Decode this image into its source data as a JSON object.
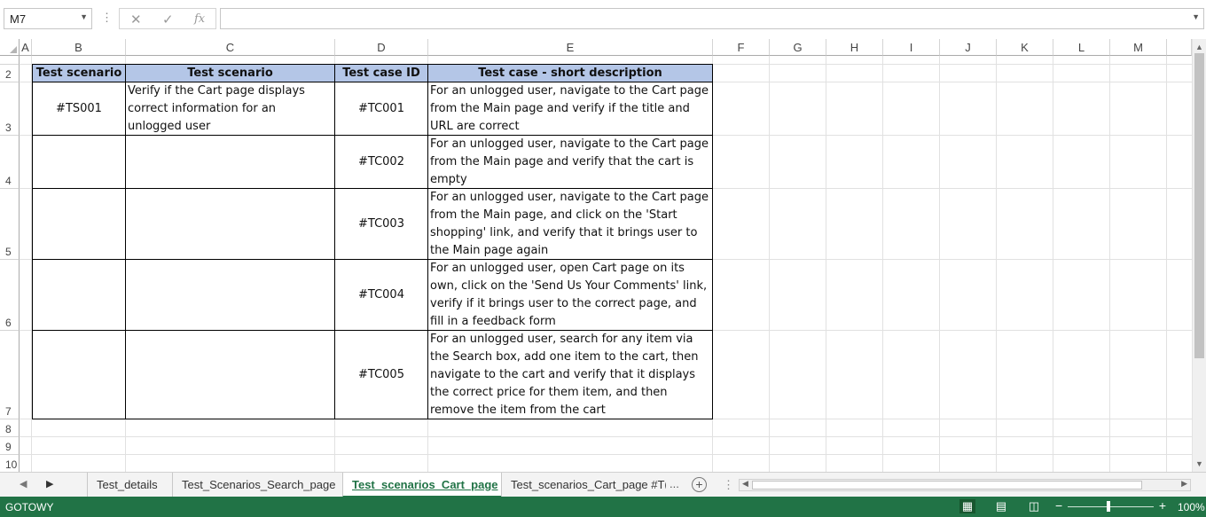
{
  "formula_bar": {
    "name_box": "M7",
    "cancel_icon": "✕",
    "enter_icon": "✓",
    "function_icon": "fx",
    "formula": ""
  },
  "columns": [
    "A",
    "B",
    "C",
    "D",
    "E",
    "F",
    "G",
    "H",
    "I",
    "J",
    "K",
    "L",
    "M"
  ],
  "rows": [
    "2",
    "3",
    "4",
    "5",
    "6",
    "7",
    "8",
    "9",
    "10"
  ],
  "table": {
    "headers": [
      "Test scenario ID",
      "Test scenario",
      "Test case ID",
      "Test case - short description"
    ],
    "rows": [
      {
        "scenario_id": "#TS001",
        "scenario": "Verify if the Cart page displays correct information for an unlogged user",
        "case_id": "#TC001",
        "description": "For an unlogged user, navigate to the Cart page from the Main page and verify if the title and URL are correct"
      },
      {
        "scenario_id": "",
        "scenario": "",
        "case_id": "#TC002",
        "description": "For an unlogged user, navigate to the Cart page from the Main page and verify that the cart is empty"
      },
      {
        "scenario_id": "",
        "scenario": "",
        "case_id": "#TC003",
        "description": "For an unlogged user, navigate to the Cart page from the Main page, and click on the 'Start shopping' link, and verify that it brings user to the Main page again"
      },
      {
        "scenario_id": "",
        "scenario": "",
        "case_id": "#TC004",
        "description": "For an unlogged user, open Cart page on its own, click on the 'Send Us Your Comments' link, verify if it brings user to the correct page, and fill in a feedback form"
      },
      {
        "scenario_id": "",
        "scenario": "",
        "case_id": "#TC005",
        "description": "For an unlogged user, search for any item via the Search box, add one item to the cart, then navigate to the cart and verify that it displays the correct price for them item, and then remove the item from the cart"
      }
    ]
  },
  "sheet_tabs": {
    "tabs": [
      "Test_details",
      "Test_Scenarios_Search_page",
      "Test_scenarios_Cart_page",
      "Test_scenarios_Cart_page #T("
    ],
    "active": "Test_scenarios_Cart_page",
    "more": "...",
    "add_icon": "+"
  },
  "status_bar": {
    "status": "GOTOWY",
    "zoom": "100%",
    "zoom_value": 100,
    "accent_color": "#217346",
    "header_fill": "#b4c6e7"
  }
}
